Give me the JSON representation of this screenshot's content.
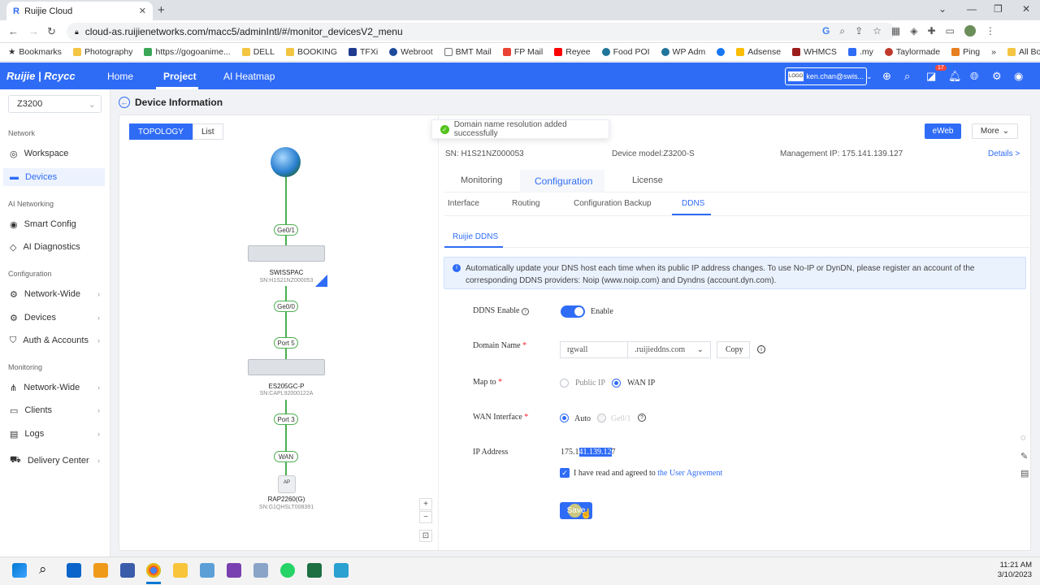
{
  "browser": {
    "tab_title": "Ruijie Cloud",
    "url": "cloud-as.ruijienetworks.com/macc5/adminIntl/#/monitor_devicesV2_menu",
    "bookmarks": [
      "Bookmarks",
      "Photography",
      "https://gogoanime...",
      "DELL",
      "BOOKING",
      "TFXi",
      "Webroot",
      "BMT Mail",
      "FP Mail",
      "Reyee",
      "Food POI",
      "WP Adm",
      "Adsense",
      "WHMCS",
      ".my",
      "Taylormade",
      "Ping"
    ],
    "all_bookmarks": "All Bookmarks"
  },
  "header": {
    "logo": "Ruijie | Rcycc",
    "nav": {
      "home": "Home",
      "project": "Project",
      "ai_heatmap": "AI Heatmap"
    },
    "account": "ken.chan@swis...",
    "account_logo": "LOGO",
    "notification_count": "17"
  },
  "sidebar": {
    "project_select": "Z3200",
    "groups": {
      "network": "Network",
      "ai_networking": "AI Networking",
      "configuration": "Configuration",
      "monitoring": "Monitoring"
    },
    "items": {
      "workspace": "Workspace",
      "devices": "Devices",
      "smart_config": "Smart Config",
      "ai_diagnostics": "AI Diagnostics",
      "network_wide_cfg": "Network-Wide",
      "devices_cfg": "Devices",
      "auth_accounts": "Auth & Accounts",
      "network_wide_mon": "Network-Wide",
      "clients": "Clients",
      "logs": "Logs",
      "delivery_center": "Delivery Center"
    }
  },
  "page": {
    "title": "Device Information",
    "view_tabs": {
      "topology": "TOPOLOGY",
      "list": "List"
    },
    "toast": "Domain name resolution added successfully",
    "eweb": "eWeb",
    "more": "More",
    "sn": "SN:  H1S21NZ000053",
    "device_model": "Device model:Z3200-S",
    "management_ip": "Management IP:  175.141.139.127",
    "details": "Details >"
  },
  "topology": {
    "ports": {
      "ge01": "Ge0/1",
      "ge00": "Ge0/0",
      "port5": "Port 5",
      "port3": "Port 3",
      "wan": "WAN"
    },
    "devices": [
      {
        "name": "SWISSPAC",
        "sn": "SN:H1S21NZ000053"
      },
      {
        "name": "ES205GC-P",
        "sn": "SN:CAPL92000122A"
      },
      {
        "name": "RAP2260(G)",
        "sn": "SN:G1QHSLT008391"
      }
    ],
    "ap_label": "AP"
  },
  "tabs": {
    "main": {
      "monitoring": "Monitoring",
      "configuration": "Configuration",
      "license": "License"
    },
    "sub": {
      "interface": "Interface",
      "routing": "Routing",
      "config_backup": "Configuration Backup",
      "ddns": "DDNS"
    },
    "provider": "Ruijie DDNS"
  },
  "form": {
    "alert": "Automatically update your DNS host each time when its public IP address changes. To use No-IP or DynDN, please register an account of the corresponding DDNS providers: Noip (www.noip.com) and Dyndns (account.dyn.com).",
    "ddns_enable_label": "DDNS Enable",
    "enable_text": "Enable",
    "domain_label": "Domain Name",
    "domain_value": "rgwall",
    "domain_suffix": ".ruijieddns.com",
    "copy": "Copy",
    "map_to_label": "Map to",
    "public_ip": "Public IP",
    "wan_ip": "WAN IP",
    "wan_interface_label": "WAN Interface",
    "auto": "Auto",
    "ge01": "Ge0/1",
    "ip_label": "IP Address",
    "ip_prefix": "175.1",
    "ip_selected": "41.139.12",
    "ip_suffix": "7",
    "agree_text": "I have read and agreed to",
    "agreement_link": "the User Agreement",
    "save": "Save",
    "required_mark": "*"
  },
  "taskbar": {
    "time": "11:21 AM",
    "date": "3/10/2023"
  }
}
